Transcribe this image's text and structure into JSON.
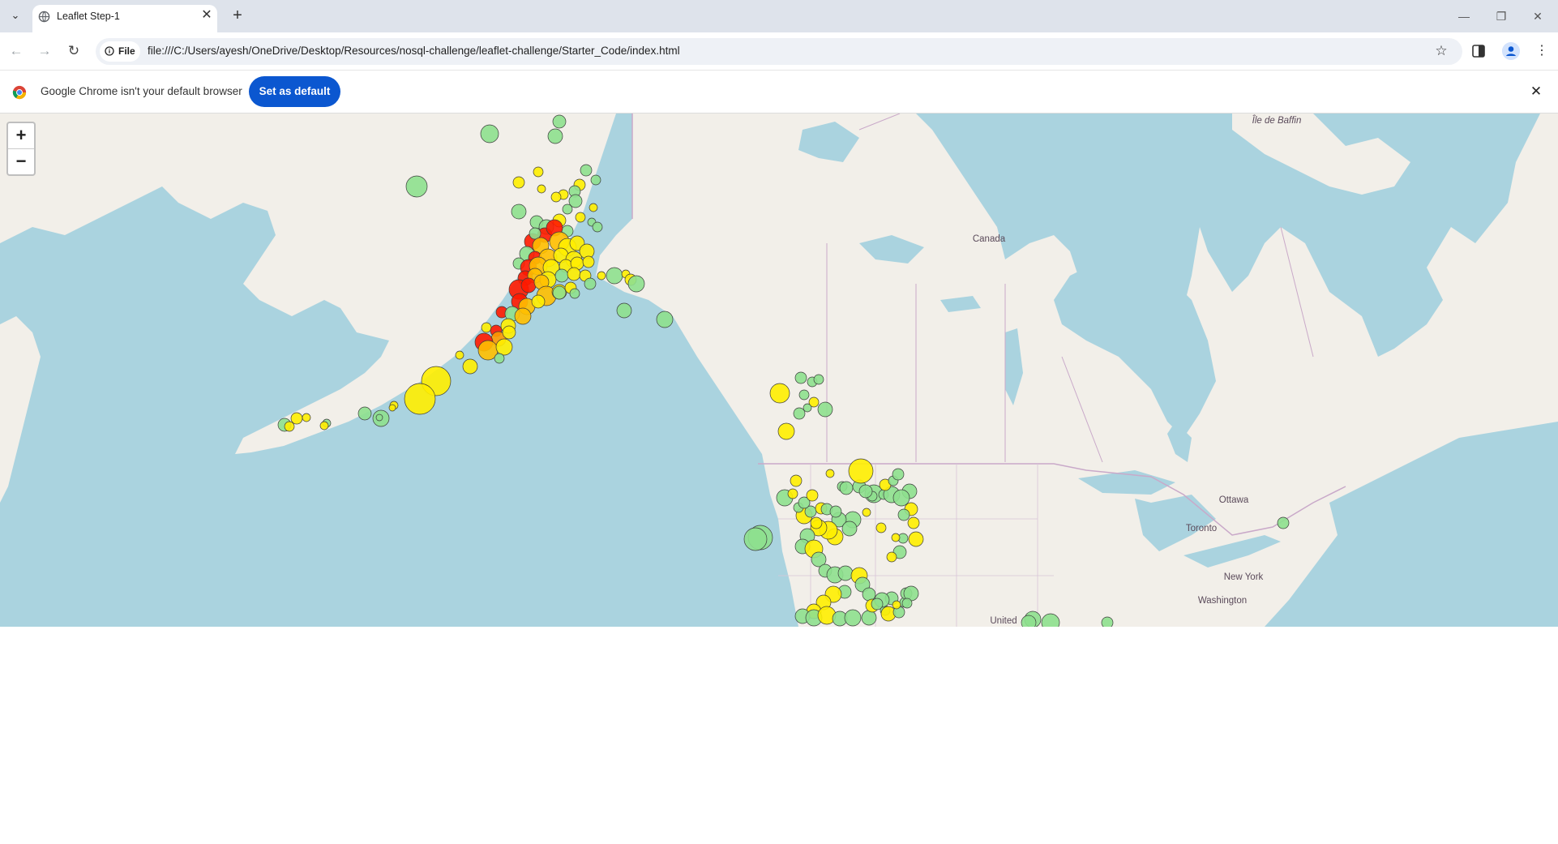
{
  "browser": {
    "tab_title": "Leaflet Step-1",
    "new_tab_symbol": "+",
    "close_symbol": "✕",
    "site_chip": "File",
    "url": "file:///C:/Users/ayesh/OneDrive/Desktop/Resources/nosql-challenge/leaflet-challenge/Starter_Code/index.html",
    "infobar_text": "Google Chrome isn't your default browser",
    "infobar_button": "Set as default"
  },
  "icons": [
    "tab-search-icon",
    "globe-icon",
    "close-icon",
    "plus-icon",
    "minimize-icon",
    "restore-icon",
    "back-icon",
    "forward-icon",
    "reload-icon",
    "info-icon",
    "star-icon",
    "side-panel-icon",
    "profile-icon",
    "more-vert-icon",
    "chrome-logo-icon"
  ],
  "map": {
    "zoom_in": "+",
    "zoom_out": "−",
    "place_labels": [
      "Île de Baffin",
      "Canada",
      "Ottawa",
      "Toronto",
      "New York",
      "Washington",
      "United"
    ],
    "marker_colors": {
      "lowest": "#8ee08e",
      "low": "#ffee00",
      "medium": "#ffbf00",
      "high": "#ff9a00",
      "highest": "#ff1a00"
    },
    "colors": {
      "water": "#aad3df",
      "land": "#f2efe9",
      "border": "#c9a9c9"
    }
  }
}
